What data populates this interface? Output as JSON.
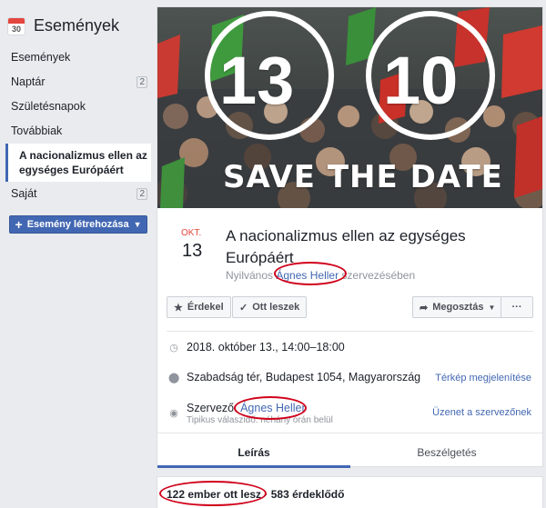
{
  "sidebar": {
    "calendar_day": "30",
    "title": "Események",
    "items": [
      {
        "label": "Események",
        "count": ""
      },
      {
        "label": "Naptár",
        "count": "2"
      },
      {
        "label": "Születésnapok",
        "count": ""
      },
      {
        "label": "Továbbiak",
        "count": ""
      }
    ],
    "active_item": "A nacionalizmus ellen az egységes Európáért",
    "own_item": {
      "label": "Saját",
      "count": "2"
    },
    "create_button": "Esemény létrehozása"
  },
  "cover": {
    "left_number": "13",
    "right_number": "10",
    "save_the_date": "SAVE THE DATE"
  },
  "event": {
    "month": "OKT.",
    "day": "13",
    "title": "A nacionalizmus ellen az egységes Európáért",
    "visibility": "Nyilvános",
    "organizer": "Ágnes Heller",
    "organized_suffix": "szervezésében"
  },
  "actions": {
    "interested": "Érdekel",
    "going": "Ott leszek",
    "share": "Megosztás",
    "more": "···"
  },
  "details": {
    "datetime": "2018. október 13., 14:00–18:00",
    "location": "Szabadság tér, Budapest 1054, Magyarország",
    "map_link": "Térkép megjelenítése",
    "organizer_label": "Szervező:",
    "organizer_name": "Ágnes Heller",
    "response_time": "Tipikus válaszidő: néhány órán belül",
    "message_link": "Üzenet a szervezőnek"
  },
  "tabs": {
    "description": "Leírás",
    "discussion": "Beszélgetés"
  },
  "stats": {
    "going": "122 ember ott lesz",
    "interested": "583 érdeklődő"
  },
  "colors": {
    "accent": "#4267b2",
    "highlight": "#d0021b",
    "month": "#e3463d"
  }
}
